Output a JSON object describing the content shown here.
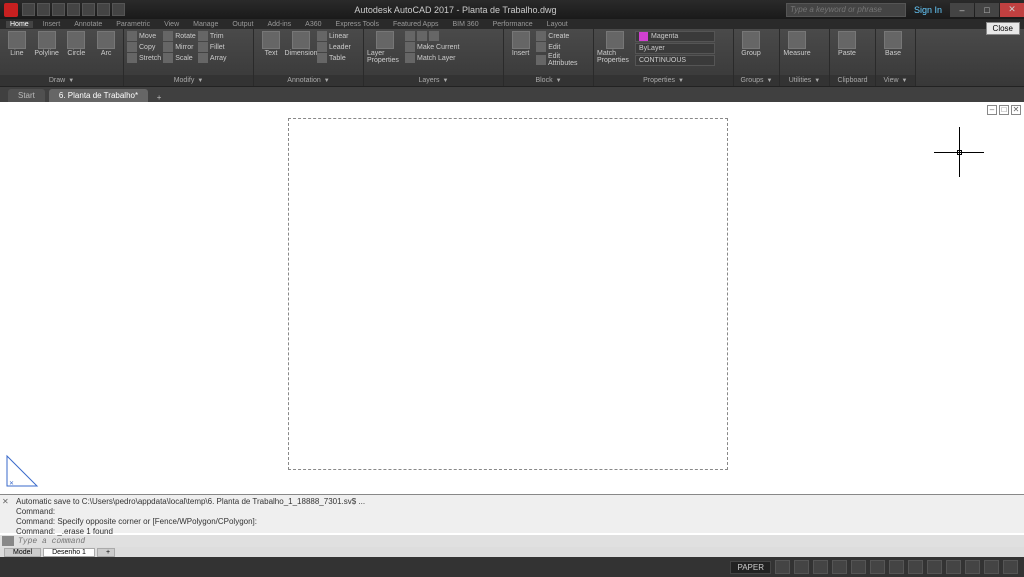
{
  "titlebar": {
    "app_title": "Autodesk AutoCAD 2017 - Planta de Trabalho.dwg",
    "search_placeholder": "Type a keyword or phrase",
    "signin": "Sign In",
    "close_label": "Close"
  },
  "ribbon_tabs": [
    "Home",
    "Insert",
    "Annotate",
    "Parametric",
    "View",
    "Manage",
    "Output",
    "Add-ins",
    "A360",
    "Express Tools",
    "Featured Apps",
    "BIM 360",
    "Performance",
    "Layout"
  ],
  "ribbon_active_tab": 0,
  "panels": {
    "draw": {
      "title": "Draw",
      "items": [
        "Line",
        "Polyline",
        "Circle",
        "Arc"
      ],
      "tri": "▼"
    },
    "modify": {
      "title": "Modify",
      "rows": [
        [
          "Move",
          "Rotate",
          "Trim"
        ],
        [
          "Copy",
          "Mirror",
          "Fillet"
        ],
        [
          "Stretch",
          "Scale",
          "Array"
        ]
      ],
      "tri": "▼"
    },
    "annotation": {
      "title": "Annotation",
      "items": [
        "Text",
        "Dimension"
      ],
      "rows": [
        [
          "Linear"
        ],
        [
          "Leader"
        ],
        [
          "Table"
        ]
      ],
      "tri": "▼"
    },
    "layers": {
      "title": "Layers",
      "btn": "Layer Properties",
      "rows": [
        [
          "Make Current"
        ],
        [
          "Match Layer"
        ]
      ],
      "tri": "▼"
    },
    "block": {
      "title": "Block",
      "btn": "Insert",
      "rows": [
        [
          "Create"
        ],
        [
          "Edit"
        ],
        [
          "Edit Attributes"
        ]
      ],
      "tri": "▼"
    },
    "properties": {
      "title": "Properties",
      "btn": "Match Properties",
      "color": "Magenta",
      "line1": "ByLayer",
      "line2": "CONTINUOUS",
      "tri": "▼"
    },
    "groups": {
      "title": "Groups",
      "btn": "Group",
      "tri": "▼"
    },
    "utilities": {
      "title": "Utilities",
      "btn": "Measure",
      "tri": "▼"
    },
    "clipboard": {
      "title": "Clipboard",
      "btn": "Paste",
      "tri": ""
    },
    "view": {
      "title": "View",
      "btn": "Base",
      "tri": "▼"
    }
  },
  "doc_tabs": {
    "items": [
      "Start",
      "6. Planta de Trabalho*"
    ],
    "active": 1,
    "plus": "+"
  },
  "layout_tabs": {
    "items": [
      "Model",
      "Desenho 1"
    ],
    "active": 1,
    "plus": "+"
  },
  "cmd": {
    "line1": "Automatic save to C:\\Users\\pedro\\appdata\\local\\temp\\6. Planta de Trabalho_1_18888_7301.sv$ ...",
    "line2": "Command:",
    "line3": "Command: Specify opposite corner or [Fence/WPolygon/CPolygon]:",
    "line4": "Command: _.erase 1 found",
    "placeholder": "Type a command"
  },
  "status": {
    "space": "PAPER"
  }
}
